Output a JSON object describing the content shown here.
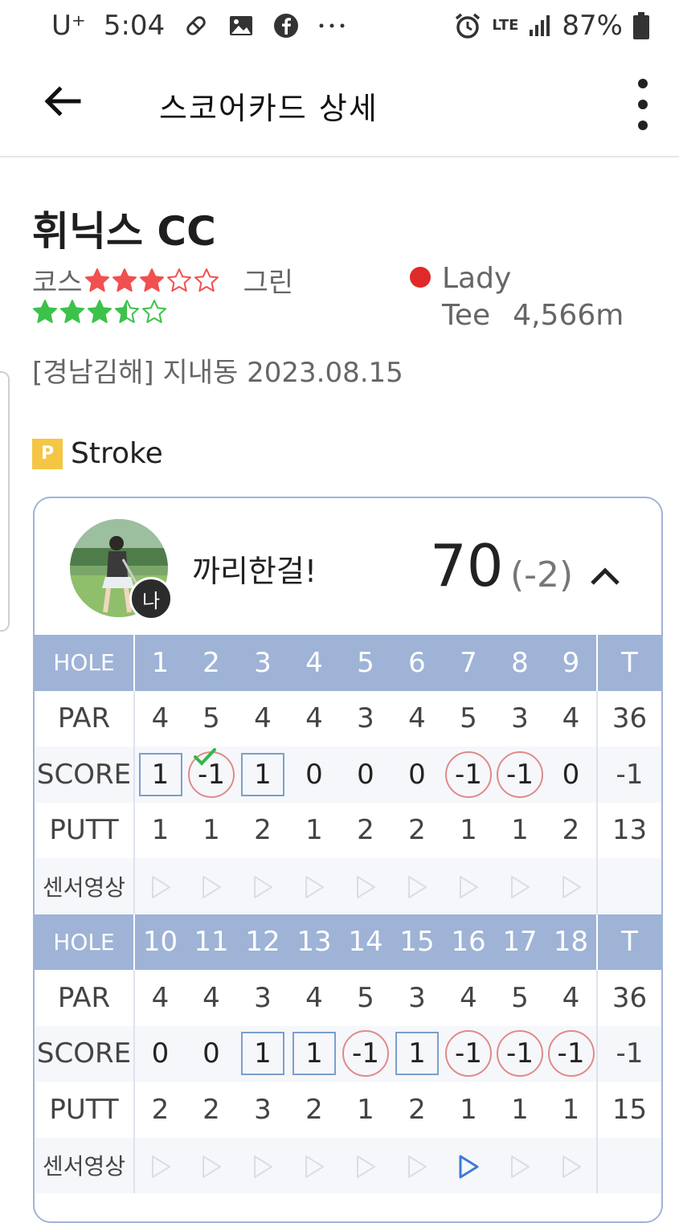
{
  "status_bar": {
    "carrier": "U⁺",
    "time": "5:04",
    "network": "LTE",
    "battery": "87%"
  },
  "app_bar": {
    "title": "스코어카드 상세"
  },
  "course": {
    "name": "휘닉스 CC",
    "course_label": "코스",
    "course_rating": 3,
    "green_label": "그린",
    "green_rating": 3.5,
    "tee_color": "#e02a2a",
    "tee_name": "Lady",
    "tee_word": "Tee",
    "tee_length": "4,566m",
    "location_date": "[경남김해] 지내동 2023.08.15"
  },
  "mode": {
    "badge": "P",
    "label": "Stroke"
  },
  "player": {
    "nickname": "까리한걸!",
    "grade_badge": "나",
    "total": "70",
    "diff": "(-2)"
  },
  "scorecard": {
    "labels": {
      "hole": "HOLE",
      "par": "PAR",
      "score": "SCORE",
      "putt": "PUTT",
      "video": "센서영상",
      "total": "T"
    },
    "front": {
      "holes": [
        "1",
        "2",
        "3",
        "4",
        "5",
        "6",
        "7",
        "8",
        "9"
      ],
      "par": [
        "4",
        "5",
        "4",
        "4",
        "3",
        "4",
        "5",
        "3",
        "4"
      ],
      "par_total": "36",
      "score": [
        "1",
        "-1",
        "1",
        "0",
        "0",
        "0",
        "-1",
        "-1",
        "0"
      ],
      "score_style": [
        "box",
        "circle",
        "box",
        "plain",
        "plain",
        "plain",
        "circle",
        "circle",
        "plain"
      ],
      "score_check": [
        false,
        true,
        false,
        false,
        false,
        false,
        false,
        false,
        false
      ],
      "score_total": "-1",
      "putt": [
        "1",
        "1",
        "2",
        "1",
        "2",
        "2",
        "1",
        "1",
        "2"
      ],
      "putt_total": "13",
      "video_active": [
        false,
        false,
        false,
        false,
        false,
        false,
        false,
        false,
        false
      ]
    },
    "back": {
      "holes": [
        "10",
        "11",
        "12",
        "13",
        "14",
        "15",
        "16",
        "17",
        "18"
      ],
      "par": [
        "4",
        "4",
        "3",
        "4",
        "5",
        "3",
        "4",
        "5",
        "4"
      ],
      "par_total": "36",
      "score": [
        "0",
        "0",
        "1",
        "1",
        "-1",
        "1",
        "-1",
        "-1",
        "-1"
      ],
      "score_style": [
        "plain",
        "plain",
        "box",
        "box",
        "circle",
        "box",
        "circle",
        "circle",
        "circle"
      ],
      "score_check": [
        false,
        false,
        false,
        false,
        false,
        false,
        false,
        false,
        false
      ],
      "score_total": "-1",
      "putt": [
        "2",
        "2",
        "3",
        "2",
        "1",
        "2",
        "1",
        "1",
        "1"
      ],
      "putt_total": "15",
      "video_active": [
        false,
        false,
        false,
        false,
        false,
        false,
        true,
        false,
        false
      ]
    }
  },
  "colors": {
    "header_blue": "#9eb3d6",
    "star_red": "#f05050",
    "star_green": "#3cc24a",
    "box_blue": "#7b9fcc",
    "circle_red": "#e08a8a",
    "total_blue": "#4d7ec8",
    "play_active": "#3f7ad6",
    "play_inactive": "#d9dde6"
  }
}
